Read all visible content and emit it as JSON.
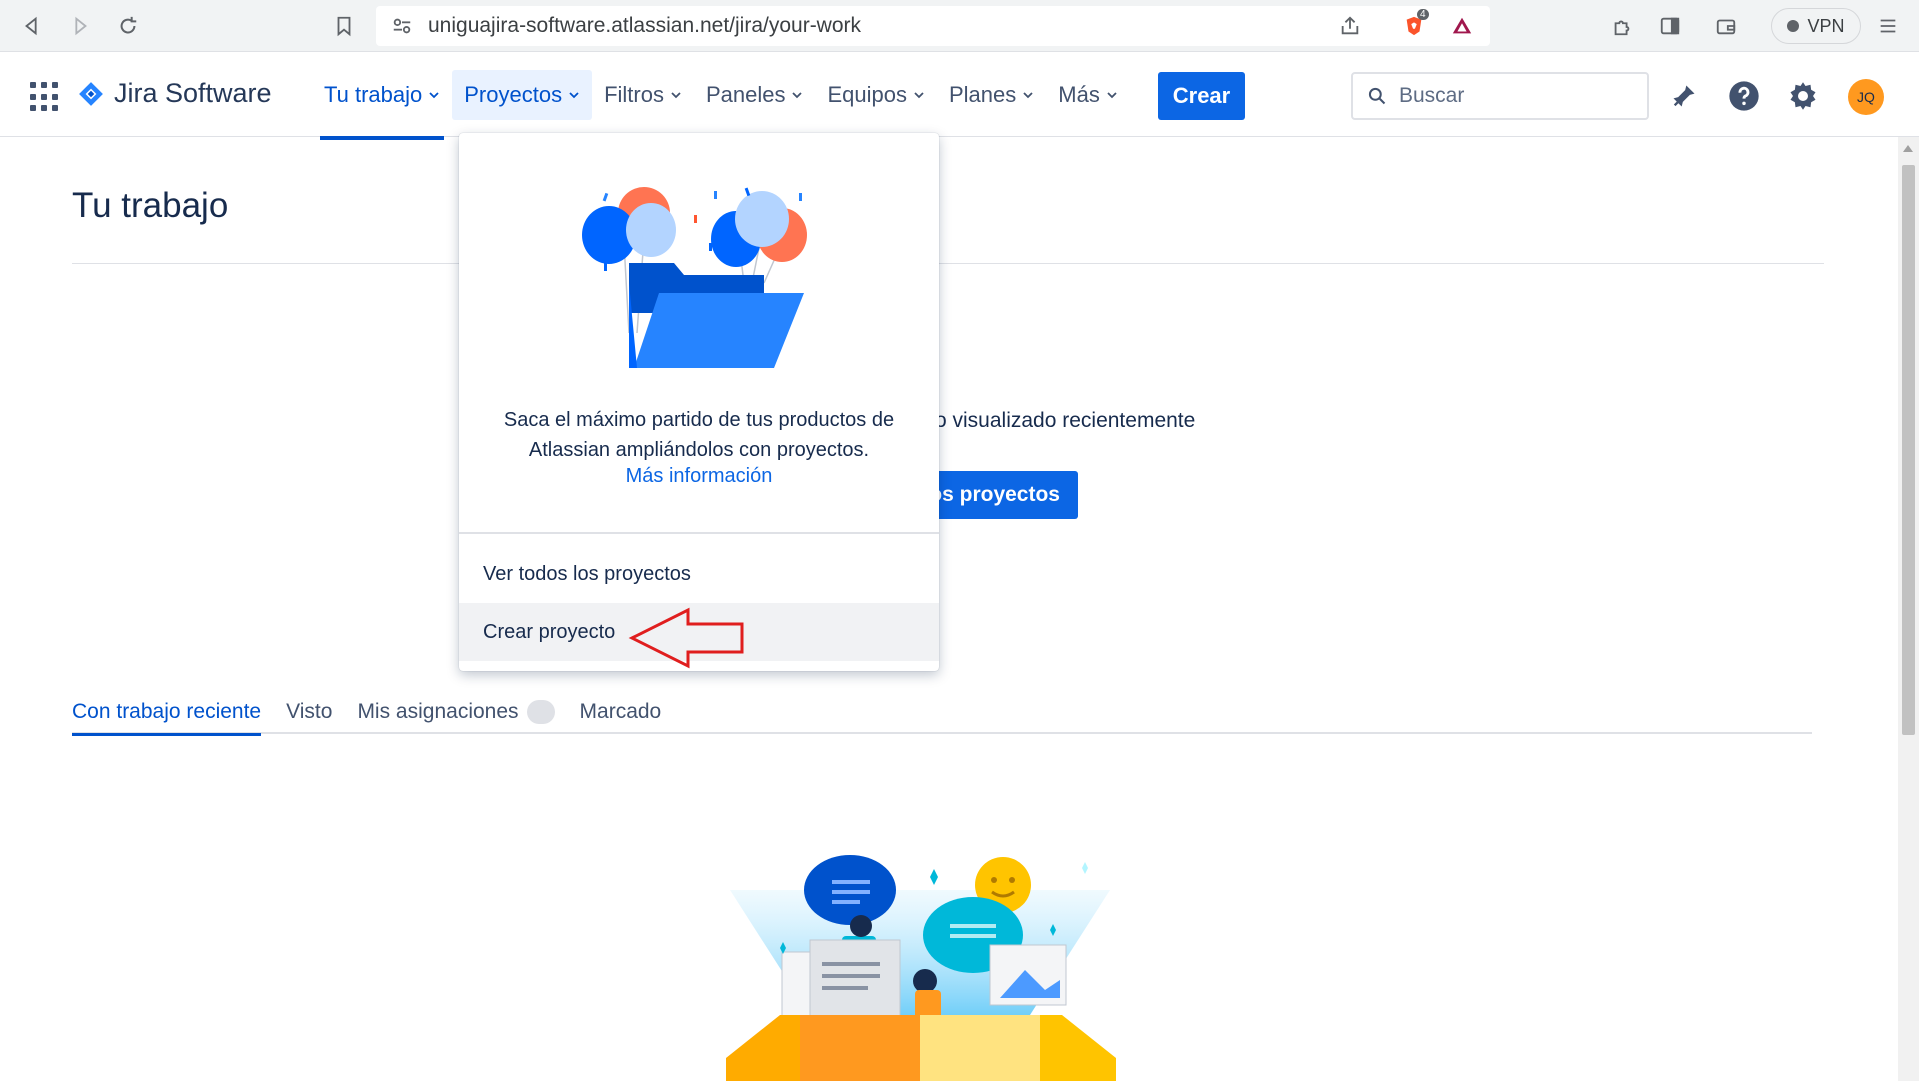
{
  "browser": {
    "url": "uniguajira-software.atlassian.net/jira/your-work",
    "shield_count": "4",
    "vpn_label": "VPN"
  },
  "header": {
    "product_name": "Jira Software",
    "nav": [
      {
        "label": "Tu trabajo",
        "state": "active"
      },
      {
        "label": "Proyectos",
        "state": "open"
      },
      {
        "label": "Filtros"
      },
      {
        "label": "Paneles"
      },
      {
        "label": "Equipos"
      },
      {
        "label": "Planes"
      },
      {
        "label": "Más"
      }
    ],
    "create_label": "Crear",
    "search_placeholder": "Buscar",
    "avatar_initials": "JQ"
  },
  "main": {
    "title": "Tu trabajo",
    "empty_text_partial": "o visualizado recientemente",
    "button_partial": "os proyectos",
    "tabs": [
      {
        "label": "Con trabajo reciente",
        "active": true
      },
      {
        "label": "Visto"
      },
      {
        "label": "Mis asignaciones",
        "badge": true
      },
      {
        "label": "Marcado"
      }
    ]
  },
  "dropdown": {
    "description": "Saca el máximo partido de tus productos de Atlassian ampliándolos con proyectos.",
    "link": "Más información",
    "items": [
      {
        "label": "Ver todos los proyectos"
      },
      {
        "label": "Crear proyecto",
        "hover": true
      }
    ]
  },
  "colors": {
    "brand_blue": "#0c66e4",
    "link_blue": "#0052cc",
    "text_dark": "#172b4d",
    "annotation_red": "#e01e1e"
  }
}
